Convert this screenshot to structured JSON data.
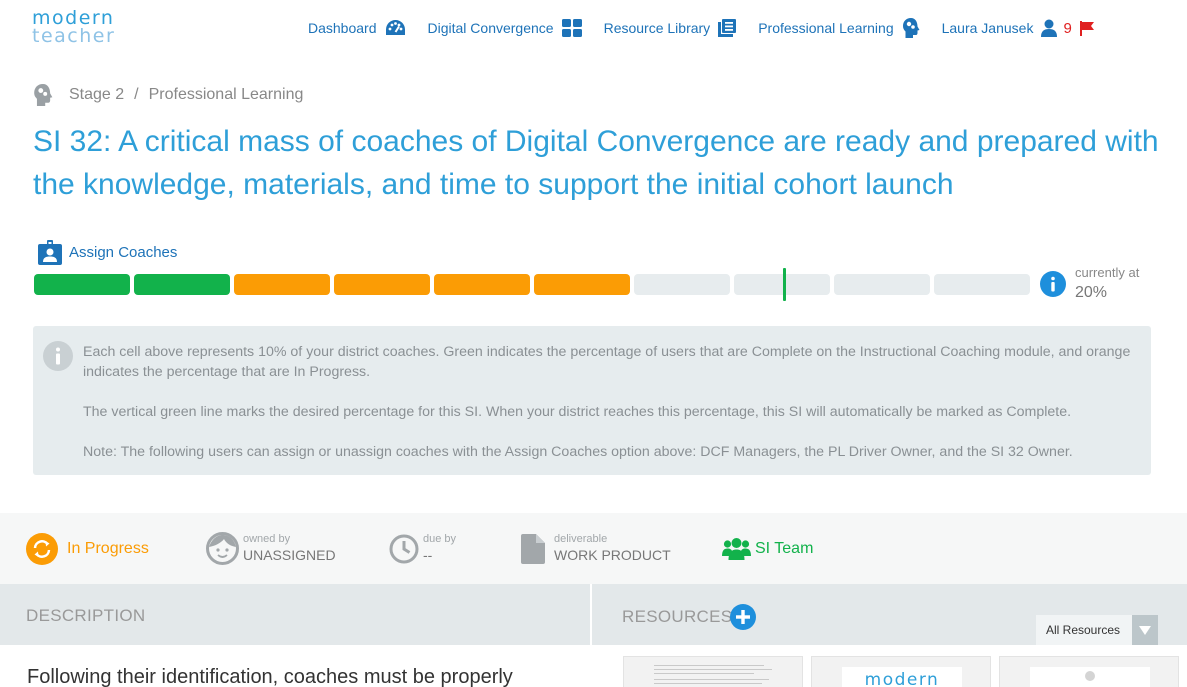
{
  "logo": {
    "line1": "modern",
    "line2": "teacher"
  },
  "nav": {
    "dashboard": "Dashboard",
    "digital_convergence": "Digital Convergence",
    "resource_library": "Resource Library",
    "professional_learning": "Professional Learning",
    "user_name": "Laura Janusek",
    "flag_count": "9"
  },
  "breadcrumb": {
    "stage": "Stage 2",
    "separator": "/",
    "section": "Professional Learning"
  },
  "title": "SI 32: A critical mass of coaches of Digital Convergence are ready and prepared with the knowledge, materials, and time to support the initial cohort launch",
  "assign": {
    "label": "Assign Coaches"
  },
  "progress": {
    "cells": [
      "complete",
      "complete",
      "inprogress",
      "inprogress",
      "inprogress",
      "inprogress",
      "empty",
      "empty",
      "empty",
      "empty"
    ],
    "target_fraction": 0.75,
    "current_label": "currently at",
    "current_value": "20%"
  },
  "info": {
    "p1": "Each cell above represents 10% of your district coaches. Green indicates the percentage of users that are Complete on the Instructional Coaching module, and orange indicates the percentage that are In Progress.",
    "p2": "The vertical green line marks the desired percentage for this SI. When your district reaches this percentage, this SI will automatically be marked as Complete.",
    "p3": "Note: The following users can assign or unassign coaches with the Assign Coaches option above: DCF Managers, the PL Driver Owner, and the SI 32 Owner."
  },
  "status": {
    "state": "In Progress",
    "owned_label": "owned by",
    "owned_value": "UNASSIGNED",
    "due_label": "due by",
    "due_value": "--",
    "deliverable_label": "deliverable",
    "deliverable_value": "WORK PRODUCT",
    "team": "SI Team"
  },
  "description": {
    "header": "DESCRIPTION",
    "body": "Following their identification, coaches must be properly"
  },
  "resources": {
    "header": "RESOURCES",
    "filter": "All Resources",
    "thumb2_text": "modern"
  },
  "colors": {
    "accent": "#2e9fd8",
    "nav": "#1e73b8",
    "complete": "#12b24b",
    "in_progress": "#fb9c05",
    "flag": "#e02020"
  }
}
